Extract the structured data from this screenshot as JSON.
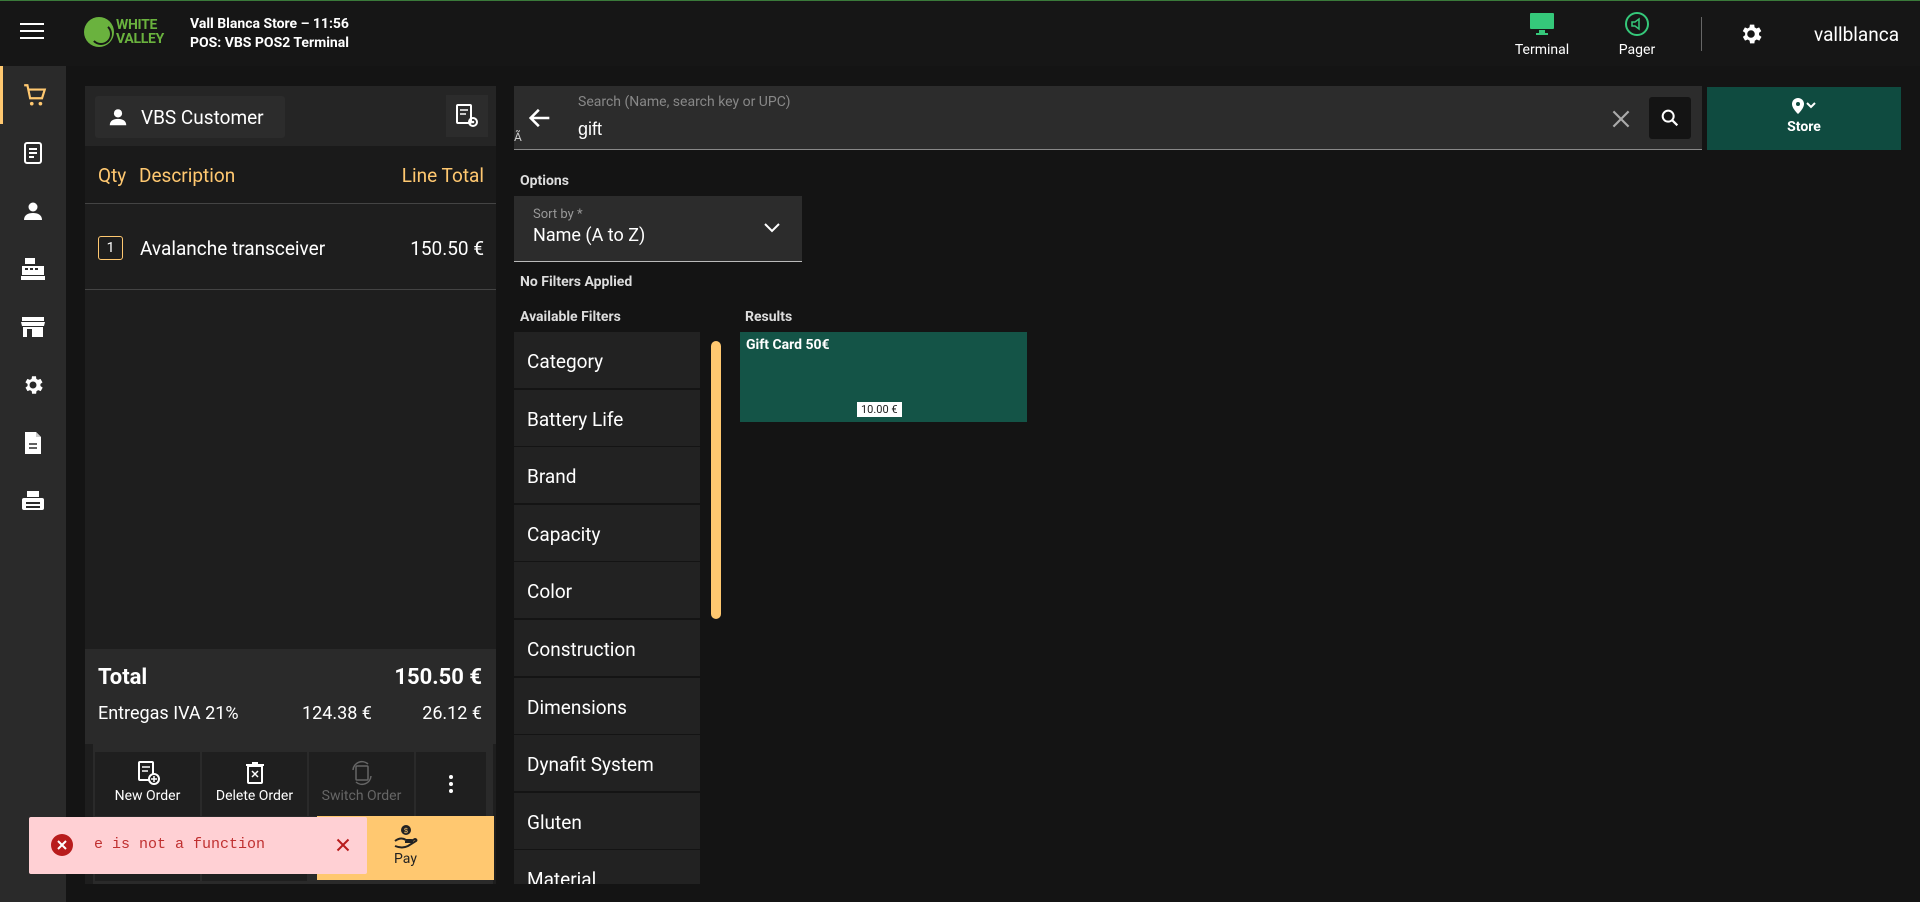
{
  "topbar": {
    "logo_line1": "WHITE",
    "logo_line2": "VALLEY",
    "store_line": "Vall Blanca Store – 11:56",
    "pos_line": "POS: VBS POS2 Terminal",
    "terminal_label": "Terminal",
    "pager_label": "Pager",
    "username": "vallblanca",
    "accent_green": "#35c87a"
  },
  "order": {
    "customer": "VBS Customer",
    "columns": {
      "qty": "Qty",
      "description": "Description",
      "line_total": "Line Total"
    },
    "lines": [
      {
        "qty": "1",
        "description": "Avalanche transceiver",
        "amount": "150.50 €"
      }
    ],
    "total_label": "Total",
    "total_value": "150.50 €",
    "tax_label": "Entregas IVA 21%",
    "tax_base": "124.38 €",
    "tax_amount": "26.12 €",
    "actions": {
      "new_order": "New Order",
      "delete_order": "Delete Order",
      "switch_order": "Switch Order",
      "pay": "Pay"
    }
  },
  "search": {
    "placeholder": "Search (Name, search key or UPC)",
    "value": "gift",
    "stray_char": "Ã",
    "store_label": "Store"
  },
  "options": {
    "options_label": "Options",
    "sort_label": "Sort by *",
    "sort_value": "Name (A to Z)",
    "no_filters": "No Filters Applied",
    "available_filters_label": "Available Filters",
    "filters": [
      "Category",
      "Battery Life",
      "Brand",
      "Capacity",
      "Color",
      "Construction",
      "Dimensions",
      "Dynafit System",
      "Gluten",
      "Material"
    ]
  },
  "results": {
    "label": "Results",
    "items": [
      {
        "name": "Gift Card 50€",
        "price": "10.00 €"
      }
    ]
  },
  "toast": {
    "message": "e is not a function"
  },
  "colors": {
    "accent": "#ffc870",
    "card_teal": "#145447",
    "store_teal": "#0f4b40",
    "error": "#b81c1c"
  }
}
